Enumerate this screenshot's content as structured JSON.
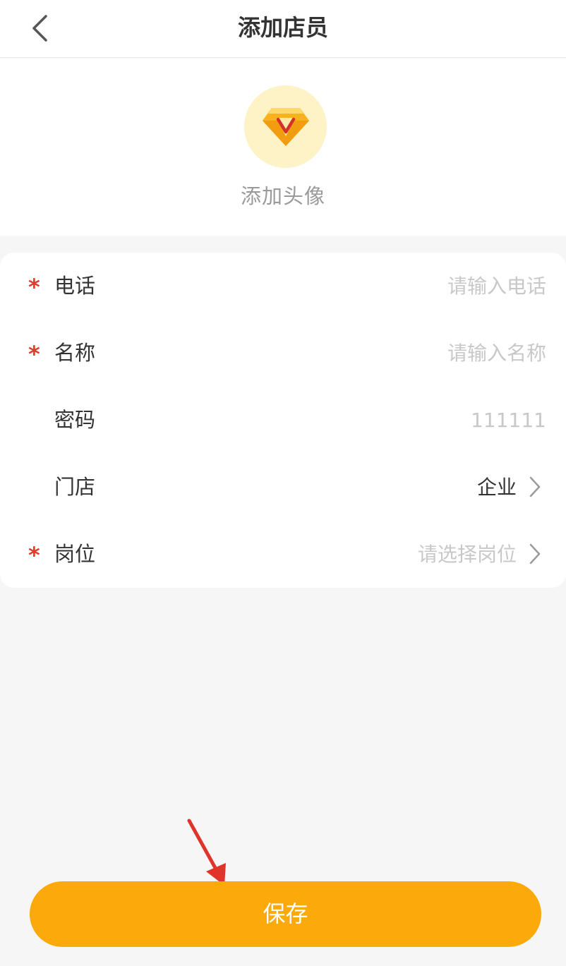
{
  "header": {
    "title": "添加店员"
  },
  "avatar": {
    "label": "添加头像"
  },
  "form": {
    "phone": {
      "label": "电话",
      "required_mark": "*",
      "placeholder": "请输入电话"
    },
    "name": {
      "label": "名称",
      "required_mark": "*",
      "placeholder": "请输入名称"
    },
    "password": {
      "label": "密码",
      "placeholder": "111111"
    },
    "store": {
      "label": "门店",
      "value": "企业"
    },
    "position": {
      "label": "岗位",
      "required_mark": "*",
      "placeholder": "请选择岗位"
    }
  },
  "save_button": {
    "label": "保存"
  },
  "colors": {
    "accent": "#fcaa0b",
    "required": "#e13b2b",
    "placeholder": "#c8c8c8",
    "text": "#333333"
  },
  "icons": {
    "back": "chevron-left-icon",
    "avatar": "diamond-vip-icon",
    "row_arrow": "chevron-right-icon",
    "annotation": "red-arrow-annotation"
  }
}
